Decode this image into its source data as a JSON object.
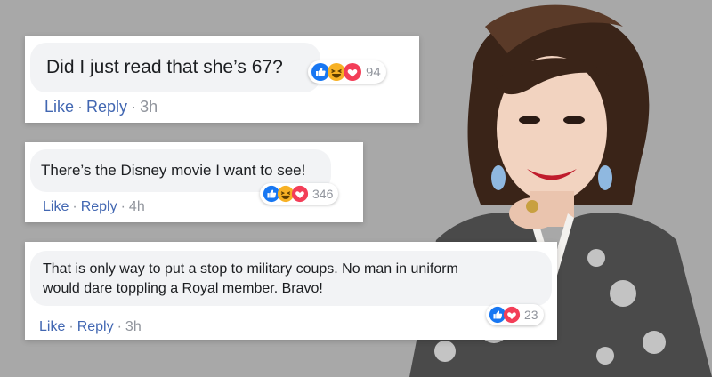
{
  "colors": {
    "background": "#a8a8a8",
    "link": "#4267b2",
    "meta": "#90949c",
    "like": "#1877f2",
    "haha": "#f7b125",
    "love": "#f33e58"
  },
  "comments": [
    {
      "text": "Did I just read that she’s 67?",
      "reactions": [
        "like-icon",
        "haha-icon",
        "love-icon"
      ],
      "count": "94",
      "like_label": "Like",
      "reply_label": "Reply",
      "time": "3h"
    },
    {
      "text": "There’s the Disney movie I want to see!",
      "reactions": [
        "like-icon",
        "haha-icon",
        "love-icon"
      ],
      "count": "346",
      "like_label": "Like",
      "reply_label": "Reply",
      "time": "4h"
    },
    {
      "text_line1": "That is only way to put a stop to military coups. No man in uniform",
      "text_line2": "would dare toppling a Royal member. Bravo!",
      "reactions": [
        "like-icon",
        "love-icon"
      ],
      "count": "23",
      "like_label": "Like",
      "reply_label": "Reply",
      "time": "3h"
    }
  ]
}
